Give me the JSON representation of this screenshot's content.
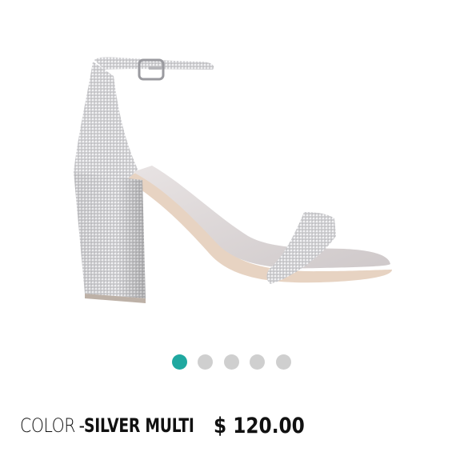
{
  "product": {
    "image_icon": "sandal-product-image"
  },
  "carousel": {
    "total": 5,
    "active_index": 0,
    "active_color": "#1fa8a0",
    "inactive_color": "#cfcfcf"
  },
  "details": {
    "color_label": "COLOR",
    "separator": "-",
    "color_value": "SILVER MULTI",
    "price": "$ 120.00"
  }
}
